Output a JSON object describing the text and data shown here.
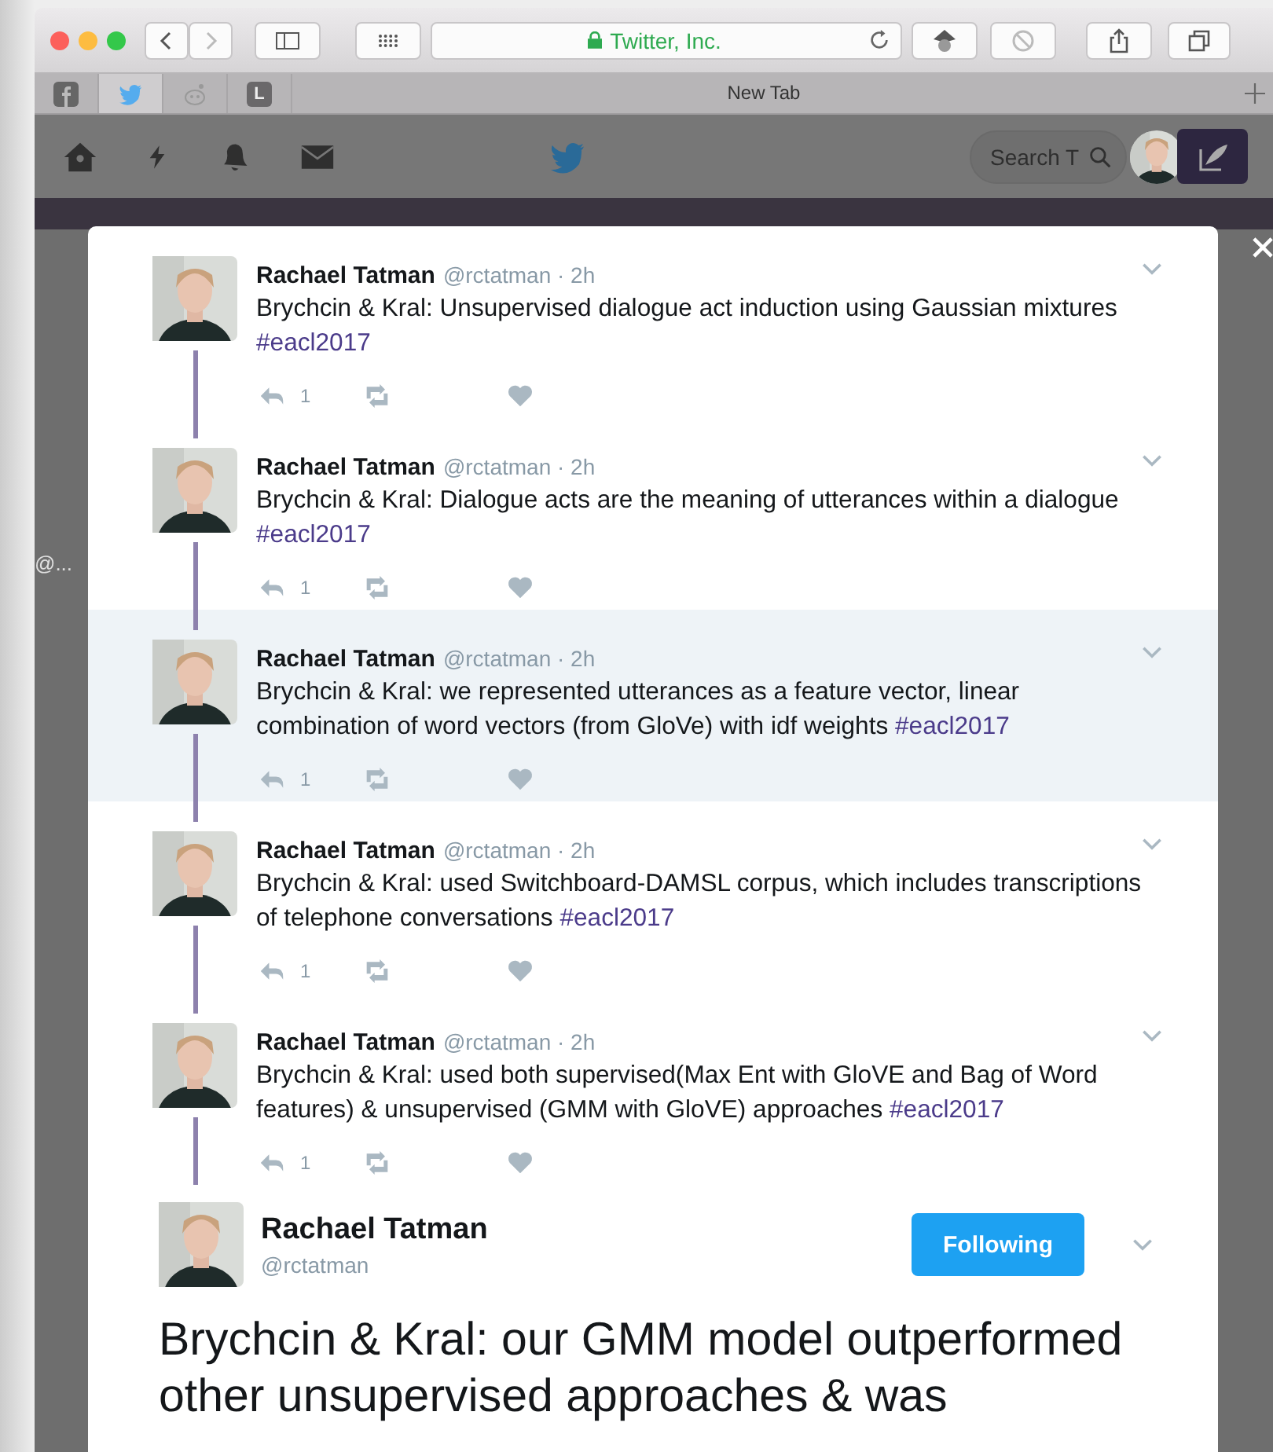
{
  "browser": {
    "address": "Twitter, Inc.",
    "tabs": [
      {
        "kind": "facebook",
        "selected": false
      },
      {
        "kind": "twitter",
        "selected": true
      },
      {
        "kind": "reddit",
        "selected": false
      },
      {
        "kind": "letter",
        "label": "L",
        "selected": false
      }
    ],
    "tab_title": "New Tab"
  },
  "site_nav": {
    "search": {
      "placeholder": "Search T"
    }
  },
  "background_text": "@...",
  "thread": [
    {
      "name": "Rachael Tatman",
      "meta": "@rctatman · 2h",
      "text": "Brychcin & Kral: Unsupervised dialogue act induction using Gaussian mixtures",
      "hashtag": "#eacl2017",
      "replies": "1",
      "highlighted": false
    },
    {
      "name": "Rachael Tatman",
      "meta": "@rctatman · 2h",
      "text": "Brychcin & Kral: Dialogue acts are the meaning of utterances within a dialogue",
      "hashtag": "#eacl2017",
      "replies": "1",
      "highlighted": false
    },
    {
      "name": "Rachael Tatman",
      "meta": "@rctatman · 2h",
      "text": "Brychcin & Kral: we represented utterances as a feature vector, linear combination of word vectors (from GloVe) with idf weights",
      "hashtag": "#eacl2017",
      "replies": "1",
      "highlighted": true
    },
    {
      "name": "Rachael Tatman",
      "meta": "@rctatman · 2h",
      "text": "Brychcin & Kral: used Switchboard-DAMSL corpus, which includes transcriptions of telephone conversations",
      "hashtag": "#eacl2017",
      "replies": "1",
      "highlighted": false
    },
    {
      "name": "Rachael Tatman",
      "meta": "@rctatman · 2h",
      "text": "Brychcin & Kral: used both supervised(Max Ent with GloVE and Bag of Word features) & unsupervised (GMM with GloVE) approaches",
      "hashtag": "#eacl2017",
      "replies": "1",
      "highlighted": false
    }
  ],
  "main_tweet": {
    "name": "Rachael Tatman",
    "handle": "@rctatman",
    "follow_button": "Following",
    "text": "Brychcin & Kral: our GMM model outperformed other unsupervised approaches & was"
  }
}
